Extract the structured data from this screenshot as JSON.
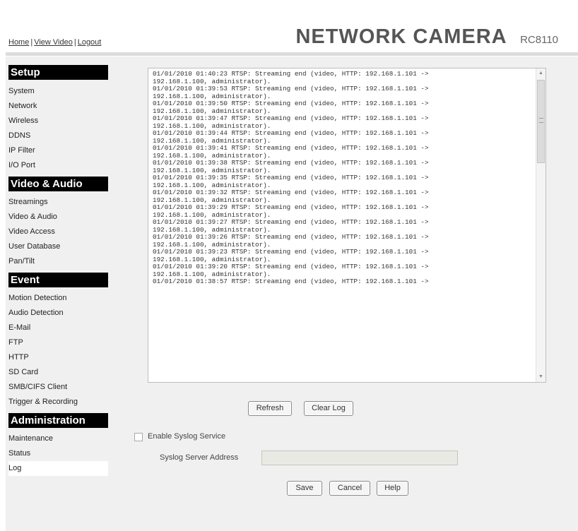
{
  "header": {
    "nav": {
      "home": "Home",
      "view_video": "View Video",
      "logout": "Logout",
      "separator": "|"
    },
    "title": "NETWORK CAMERA",
    "model": "RC8110"
  },
  "sidebar": {
    "sections": [
      {
        "heading": "Setup",
        "items": [
          "System",
          "Network",
          "Wireless",
          "DDNS",
          "IP Filter",
          "I/O Port"
        ]
      },
      {
        "heading": "Video & Audio",
        "items": [
          "Streamings",
          "Video & Audio",
          "Video Access",
          "User Database",
          "Pan/Tilt"
        ]
      },
      {
        "heading": "Event",
        "items": [
          "Motion Detection",
          "Audio Detection",
          "E-Mail",
          "FTP",
          "HTTP",
          "SD Card",
          "SMB/CIFS Client",
          "Trigger & Recording"
        ]
      },
      {
        "heading": "Administration",
        "items": [
          "Maintenance",
          "Status",
          "Log"
        ]
      }
    ],
    "active_item": "Log"
  },
  "log": {
    "entries": [
      "01/01/2010 01:40:23 RTSP: Streaming end (video, HTTP: 192.168.1.101 ->\n192.168.1.100, administrator).",
      "01/01/2010 01:39:53 RTSP: Streaming end (video, HTTP: 192.168.1.101 ->\n192.168.1.100, administrator).",
      "01/01/2010 01:39:50 RTSP: Streaming end (video, HTTP: 192.168.1.101 ->\n192.168.1.100, administrator).",
      "01/01/2010 01:39:47 RTSP: Streaming end (video, HTTP: 192.168.1.101 ->\n192.168.1.100, administrator).",
      "01/01/2010 01:39:44 RTSP: Streaming end (video, HTTP: 192.168.1.101 ->\n192.168.1.100, administrator).",
      "01/01/2010 01:39:41 RTSP: Streaming end (video, HTTP: 192.168.1.101 ->\n192.168.1.100, administrator).",
      "01/01/2010 01:39:38 RTSP: Streaming end (video, HTTP: 192.168.1.101 ->\n192.168.1.100, administrator).",
      "01/01/2010 01:39:35 RTSP: Streaming end (video, HTTP: 192.168.1.101 ->\n192.168.1.100, administrator).",
      "01/01/2010 01:39:32 RTSP: Streaming end (video, HTTP: 192.168.1.101 ->\n192.168.1.100, administrator).",
      "01/01/2010 01:39:29 RTSP: Streaming end (video, HTTP: 192.168.1.101 ->\n192.168.1.100, administrator).",
      "01/01/2010 01:39:27 RTSP: Streaming end (video, HTTP: 192.168.1.101 ->\n192.168.1.100, administrator).",
      "01/01/2010 01:39:26 RTSP: Streaming end (video, HTTP: 192.168.1.101 ->\n192.168.1.100, administrator).",
      "01/01/2010 01:39:23 RTSP: Streaming end (video, HTTP: 192.168.1.101 ->\n192.168.1.100, administrator).",
      "01/01/2010 01:39:20 RTSP: Streaming end (video, HTTP: 192.168.1.101 ->\n192.168.1.100, administrator).",
      "01/01/2010 01:38:57 RTSP: Streaming end (video, HTTP: 192.168.1.101 ->"
    ],
    "refresh_label": "Refresh",
    "clear_label": "Clear Log"
  },
  "syslog": {
    "enable_label": "Enable Syslog Service",
    "enabled": false,
    "server_label": "Syslog Server Address",
    "server_value": ""
  },
  "actions": {
    "save": "Save",
    "cancel": "Cancel",
    "help": "Help"
  },
  "icons": {
    "scroll_up": "scroll-up-arrow-icon",
    "scroll_down": "scroll-down-arrow-icon",
    "checkbox": "checkbox-icon",
    "grip": "grip-icon"
  },
  "colors": {
    "section_heading_bg": "#000000",
    "panel_bg": "#f0f0f0",
    "title_text": "#555555"
  }
}
